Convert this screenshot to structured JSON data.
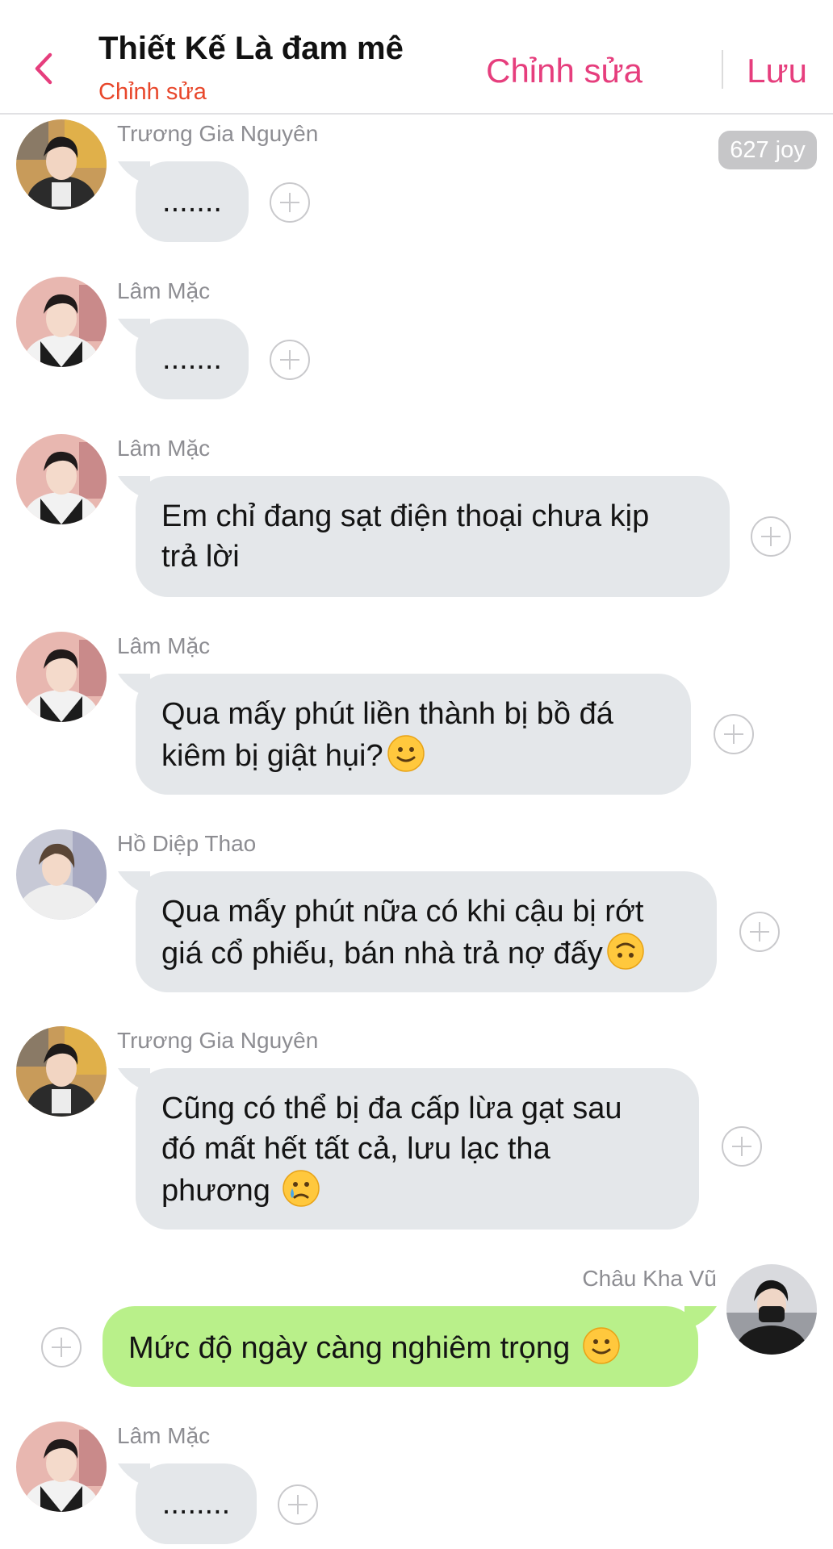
{
  "header": {
    "title": "Thiết Kế Là đam mê",
    "subtitle": "Chỉnh sửa",
    "edit_label": "Chỉnh sửa",
    "save_label": "Lưu"
  },
  "joy_badge": "627 joy",
  "messages": [
    {
      "sender": "Trương Gia Nguyên",
      "text": "......."
    },
    {
      "sender": "Lâm Mặc",
      "text": "......."
    },
    {
      "sender": "Lâm Mặc",
      "line1": "Em chỉ đang sạt điện thoại chưa kịp",
      "line2": "trả lời"
    },
    {
      "sender": "Lâm Mặc",
      "line1": "Qua mấy phút liền thành bị bồ đá",
      "line2": "kiêm bị giật hụi?",
      "emoji": "slight-smile"
    },
    {
      "sender": "Hồ Diệp Thao",
      "line1": "Qua mấy phút nữa có khi cậu bị rớt",
      "line2": "giá cổ phiếu, bán nhà trả nợ đấy",
      "emoji": "upside-down-face"
    },
    {
      "sender": "Trương Gia Nguyên",
      "line1": "Cũng có thể bị đa cấp lừa gạt sau",
      "line2": "đó mất hết tất cả, lưu lạc tha",
      "line3": "phương ",
      "emoji": "crying-face"
    },
    {
      "sender": "Châu Kha Vũ",
      "text": "Mức độ ngày càng nghiêm trọng ",
      "emoji": "slight-smile"
    },
    {
      "sender": "Lâm Mặc",
      "text": "........"
    }
  ],
  "colors": {
    "accent": "#e63e7d",
    "subtitle": "#e8472b",
    "bubble_incoming": "#e4e7ea",
    "bubble_outgoing": "#b9f08a"
  }
}
